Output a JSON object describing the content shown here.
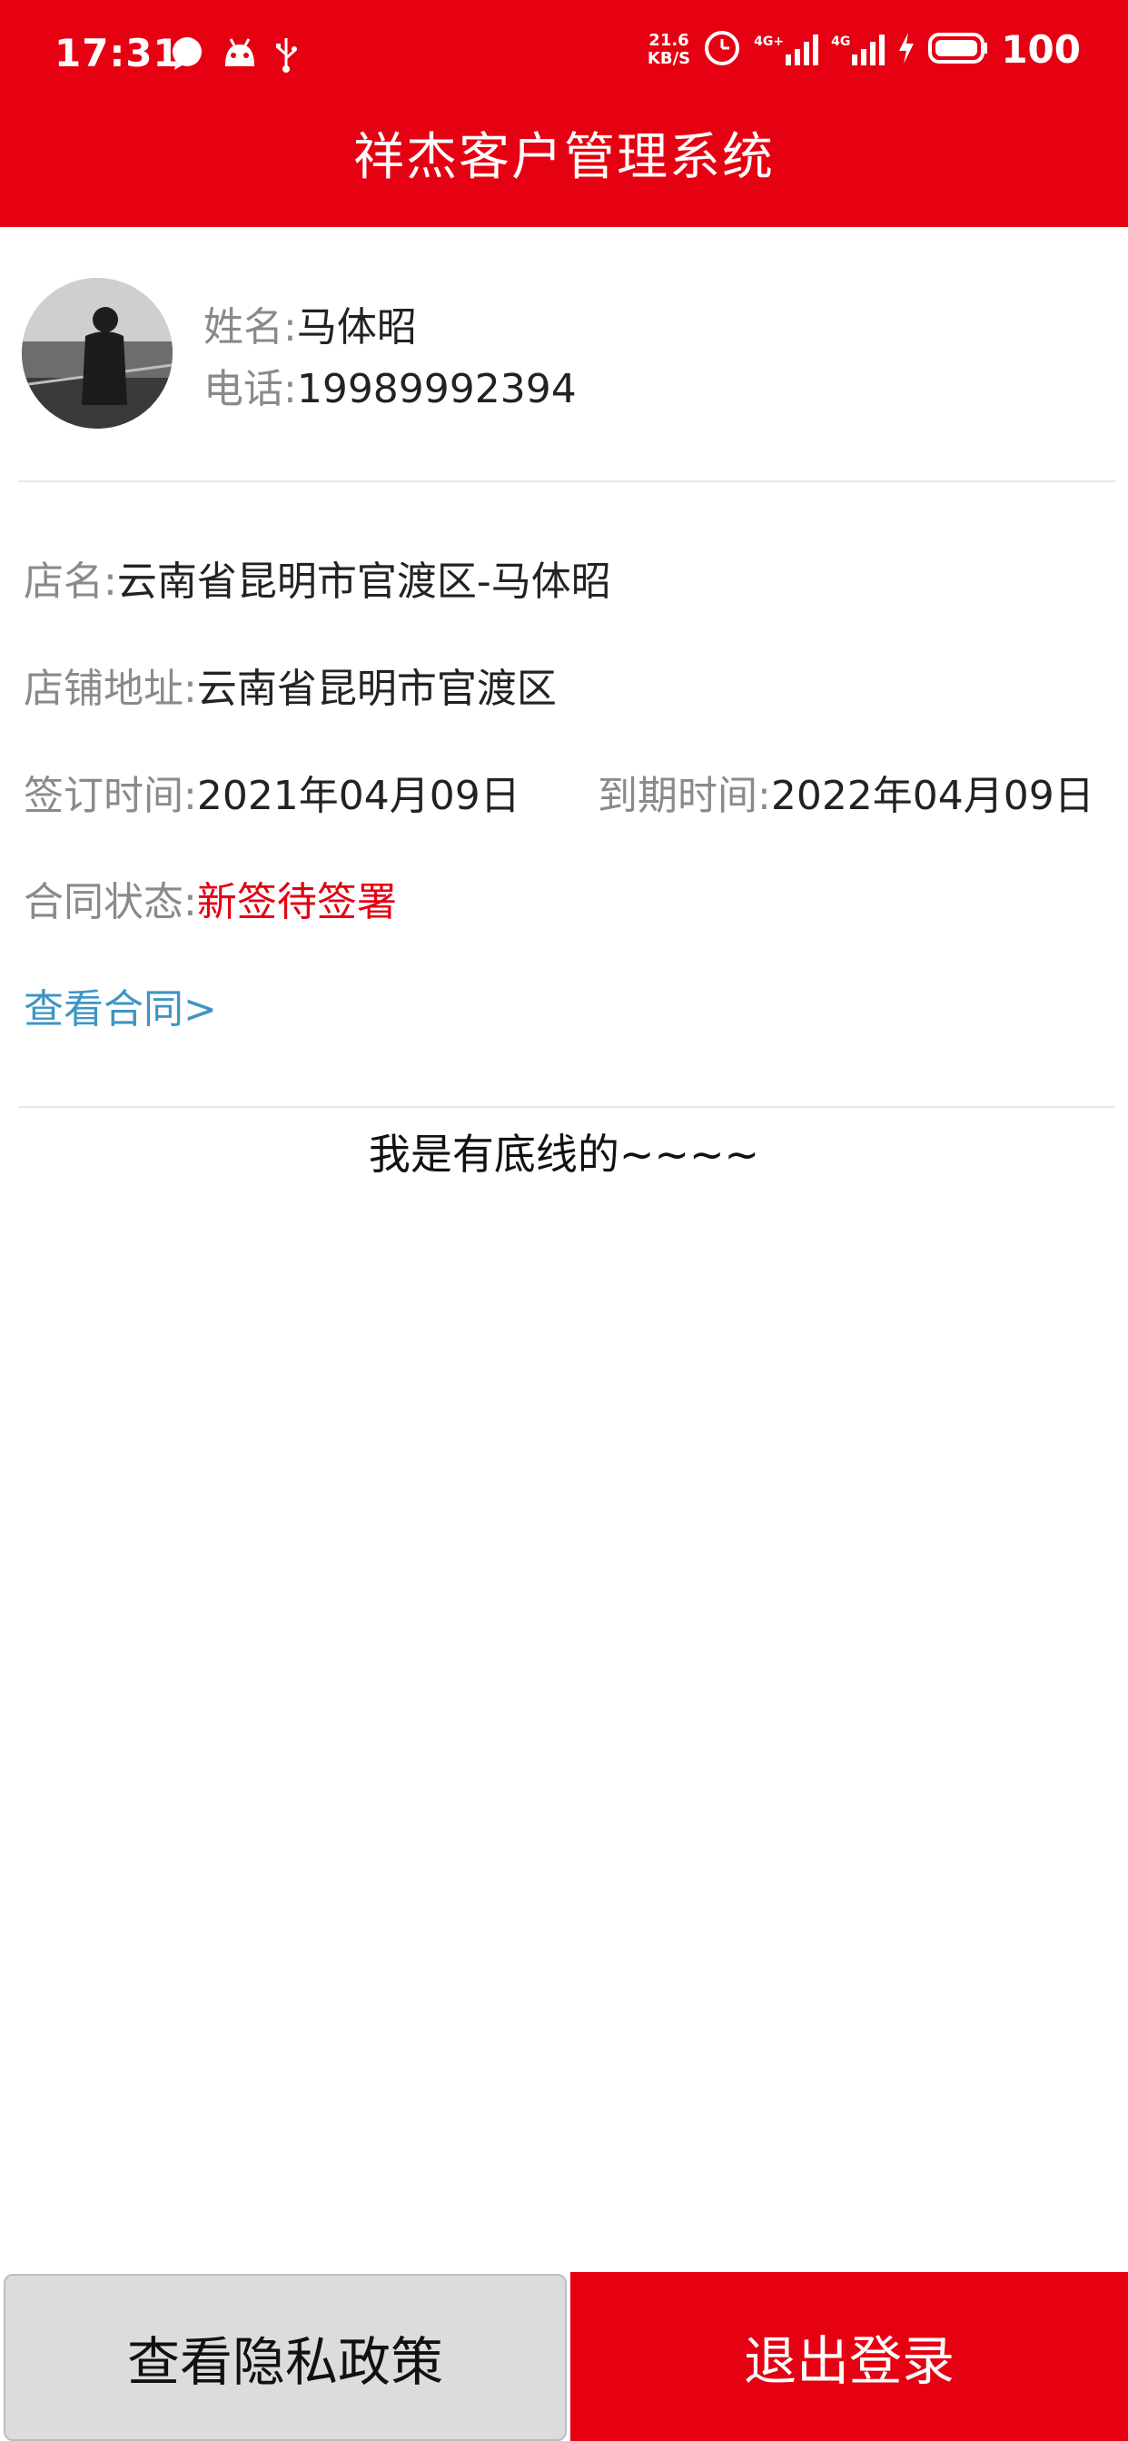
{
  "status_bar": {
    "time": "17:31",
    "net_speed_value": "21.6",
    "net_speed_unit": "KB/S",
    "signal_1": "4G+",
    "signal_2": "4G",
    "battery": "100"
  },
  "header": {
    "title": "祥杰客户管理系统"
  },
  "profile": {
    "name_label": "姓名:",
    "name_value": "马体昭",
    "phone_label": "电话:",
    "phone_value": "19989992394"
  },
  "details": {
    "store_name_label": "店名:",
    "store_name_value": "云南省昆明市官渡区-马体昭",
    "address_label": "店铺地址:",
    "address_value": "云南省昆明市官渡区",
    "sign_time_label": "签订时间:",
    "sign_time_value": "2021年04月09日",
    "expire_time_label": "到期时间:",
    "expire_time_value": "2022年04月09日",
    "contract_status_label": "合同状态:",
    "contract_status_value": "新签待签署",
    "view_contract_link": "查看合同>"
  },
  "footer_text": "我是有底线的~~~~",
  "buttons": {
    "privacy_label": "查看隐私政策",
    "logout_label": "退出登录"
  },
  "colors": {
    "brand_red": "#e50012",
    "link_blue": "#3e95c4"
  }
}
